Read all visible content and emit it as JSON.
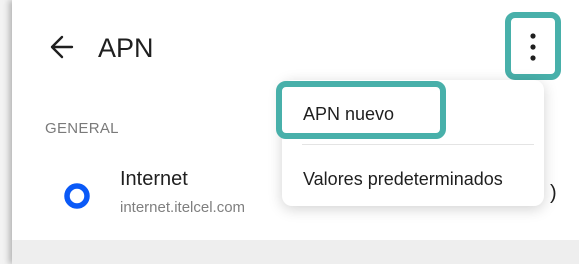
{
  "header": {
    "title": "APN",
    "back_icon": "arrow-left-icon",
    "more_icon": "more-vertical-icon"
  },
  "section": {
    "label": "GENERAL"
  },
  "apn_list": [
    {
      "name": "Internet",
      "apn": "internet.itelcel.com",
      "selected": true,
      "trailing_text": ")"
    }
  ],
  "overflow_menu": {
    "items": [
      {
        "label": "APN nuevo",
        "highlighted": true
      },
      {
        "label": "Valores predeterminados",
        "highlighted": false
      }
    ]
  },
  "colors": {
    "accent": "#0a59f7",
    "highlight_outline": "#48b0aa",
    "text_primary": "#1f1f1f",
    "text_secondary": "#7f7f7f"
  }
}
